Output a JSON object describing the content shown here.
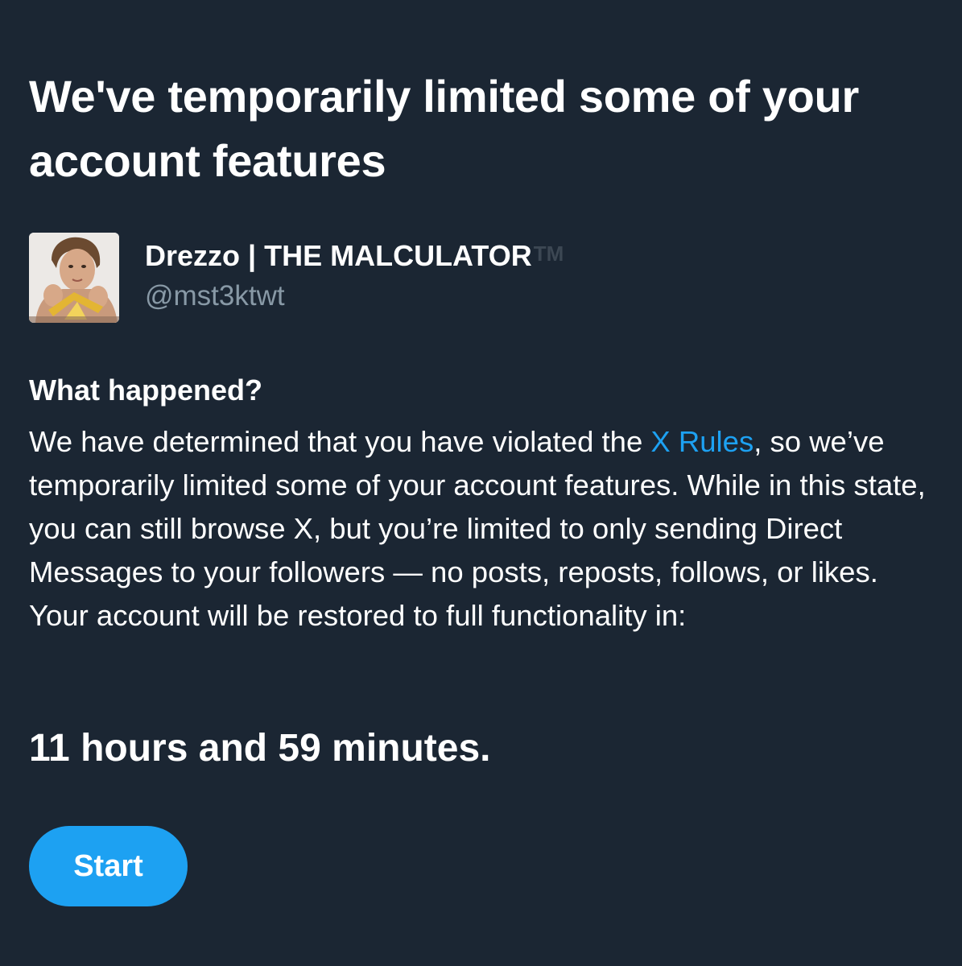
{
  "header": {
    "title": "We've temporarily limited some of your account features"
  },
  "account": {
    "display_name": "Drezzo | THE MALCULATOR",
    "trademark": "TM",
    "handle": "@mst3ktwt",
    "avatar_icon": "profile-photo"
  },
  "notice": {
    "heading": "What happened?",
    "body_before_link": "We have determined that you have violated the ",
    "link_label": "X Rules",
    "body_after_link": ", so we’ve temporarily limited some of your account features. While in this state, you can still browse X, but you’re limited to only sending Direct Messages to your followers — no posts, reposts, follows, or likes. Your account will be restored to full functionality in:",
    "countdown": "11 hours and 59 minutes."
  },
  "actions": {
    "start_label": "Start"
  },
  "colors": {
    "background": "#1b2633",
    "accent": "#1da1f2",
    "secondary_text": "#8899a6"
  }
}
